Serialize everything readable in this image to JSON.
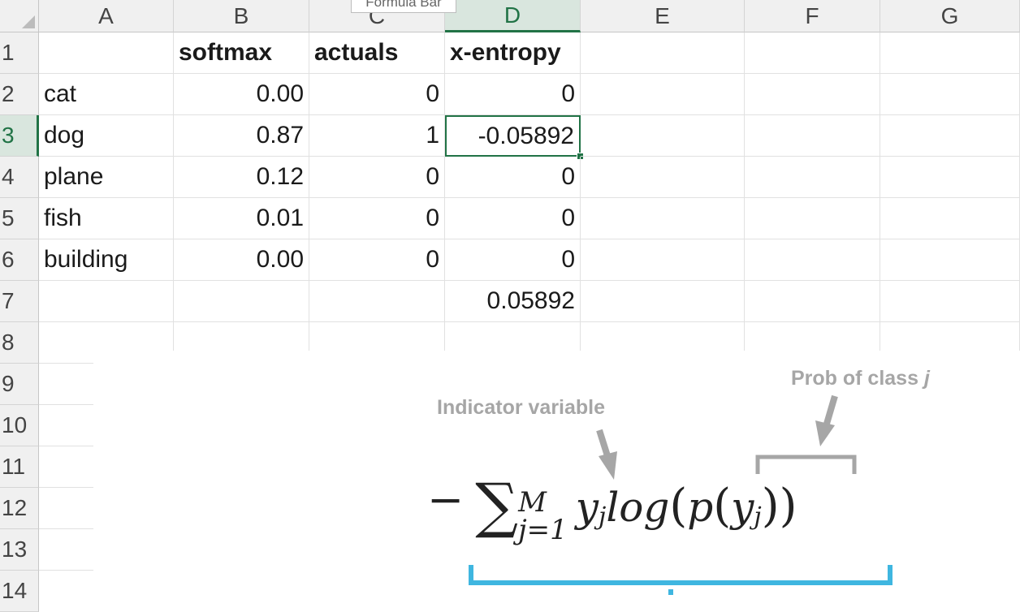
{
  "columns": [
    "A",
    "B",
    "C",
    "D",
    "E",
    "F",
    "G"
  ],
  "selected_column": "D",
  "rows": [
    "1",
    "2",
    "3",
    "4",
    "5",
    "6",
    "7",
    "8",
    "9",
    "10",
    "11",
    "12",
    "13",
    "14"
  ],
  "selected_row": "3",
  "tooltip": "Formula Bar",
  "cells": {
    "B1": "softmax",
    "C1": "actuals",
    "D1": "x-entropy",
    "A2": "cat",
    "B2": "0.00",
    "C2": "0",
    "D2": "0",
    "A3": "dog",
    "B3": "0.87",
    "C3": "1",
    "D3": "-0.05892",
    "A4": "plane",
    "B4": "0.12",
    "C4": "0",
    "D4": "0",
    "A5": "fish",
    "B5": "0.01",
    "C5": "0",
    "D5": "0",
    "A6": "building",
    "B6": "0.00",
    "C6": "0",
    "D6": "0",
    "D7": "0.05892"
  },
  "active_cell": "D3",
  "annotations": {
    "indicator": "Indicator variable",
    "prob_prefix": "Prob of class ",
    "prob_var": "j"
  },
  "formula": {
    "minus": "−",
    "sum": "∑",
    "upper": "M",
    "lower": "j=1",
    "y": "y",
    "sub": "j",
    "log": "log",
    "open": "(",
    "p": "p",
    "close": ")"
  },
  "colors": {
    "excel_green": "#217346",
    "annotation_gray": "#a6a6a6",
    "bracket_blue": "#3fb6e0"
  }
}
